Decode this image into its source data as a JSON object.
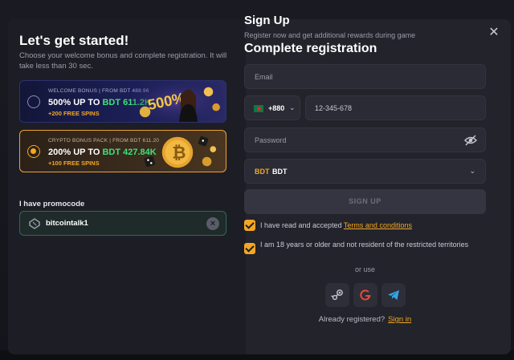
{
  "left": {
    "title": "Let's get started!",
    "subtitle": "Choose your welcome bonus and complete registration. It will take less than 30 sec.",
    "bonuses": [
      {
        "header": "WELCOME BONUS | FROM BDT 488.96",
        "main_prefix": "500% UP TO ",
        "main_amount": "BDT 611.2K",
        "spins": "+200 FREE SPINS",
        "badge": "500%",
        "selected": false
      },
      {
        "header": "CRYPTO BONUS PACK | FROM BDT 611.20",
        "main_prefix": "200% UP TO ",
        "main_amount": "BDT 427.84K",
        "spins": "+100 FREE SPINS",
        "selected": true
      }
    ],
    "promo_label": "I have promocode",
    "promo_value": "bitcointalk1"
  },
  "right": {
    "title": "Sign Up",
    "subtitle": "Register now and get additional rewards during game",
    "heading": "Complete registration",
    "email_placeholder": "Email",
    "phone_code": "+880",
    "phone_placeholder": "12-345-678",
    "password_placeholder": "Password",
    "currency_code": "BDT",
    "currency_name": "BDT",
    "signup_label": "SIGN UP",
    "terms_prefix": "I have read and accepted ",
    "terms_link": "Terms and conditions",
    "age_text": "I am 18 years or older and not resident of the restricted territories",
    "or_use": "or use",
    "already": "Already registered?",
    "signin_link": "Sign in"
  },
  "icons": {
    "close": "close-icon",
    "steam": "steam-icon",
    "google": "google-icon",
    "telegram": "telegram-icon",
    "eye": "eye-off-icon"
  },
  "colors": {
    "accent": "#f5a623",
    "green": "#3ee07a"
  }
}
